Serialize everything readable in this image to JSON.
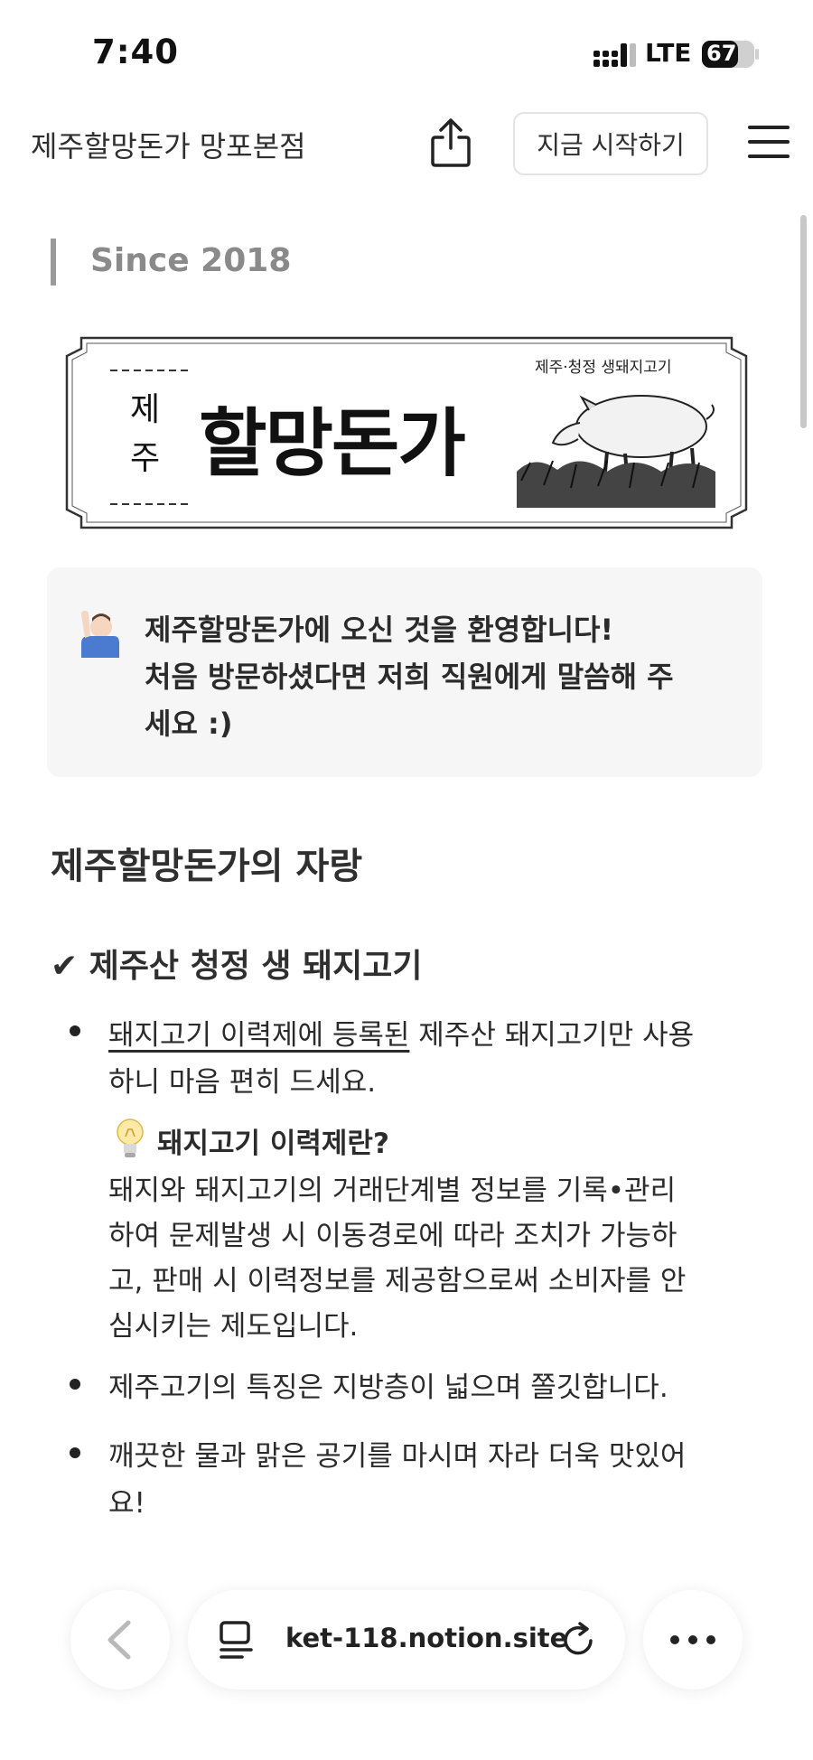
{
  "status": {
    "time": "7:40",
    "network": "LTE",
    "battery": "67"
  },
  "header": {
    "title": "제주할망돈가 망포본점",
    "start_label": "지금 시작하기"
  },
  "since": "Since 2018",
  "banner": {
    "subtitle": "제주·청정 생돼지고기",
    "jeju_top": "제",
    "jeju_bottom": "주",
    "brand": "할망돈가"
  },
  "callout": {
    "lines": [
      "제주할망돈가에 오신 것을 환영합니다!",
      "처음 방문하셨다면 저희 직원에게 말씀해 주",
      "세요 :)"
    ]
  },
  "section": {
    "title": "제주할망돈가의 자랑",
    "subtitle": "✔ 제주산 청정 생 돼지고기",
    "bullet1": {
      "link": "돼지고기 이력제에 등록된",
      "line1_rest": " 제주산 돼지고기만 사용",
      "line2": "하니 마음 편히 드세요."
    },
    "tip": {
      "title": "돼지고기 이력제란?",
      "lines": [
        "돼지와 돼지고기의 거래단계별 정보를 기록•관리",
        "하여 문제발생 시 이동경로에 따라 조치가 가능하",
        "고, 판매 시 이력정보를 제공함으로써 소비자를 안",
        "심시키는 제도입니다."
      ]
    },
    "bullet2": "제주고기의 특징은 지방층이 넓으며 쫄깃합니다.",
    "bullet3": {
      "line1": "깨끗한 물과 맑은 공기를 마시며 자라 더욱 맛있어",
      "line2": "요!"
    }
  },
  "browser": {
    "url": "ket-118.notion.site"
  },
  "colors": {
    "text": "#2b2b2b",
    "callout_bg": "#f6f6f6",
    "muted": "#8a8a8a"
  }
}
